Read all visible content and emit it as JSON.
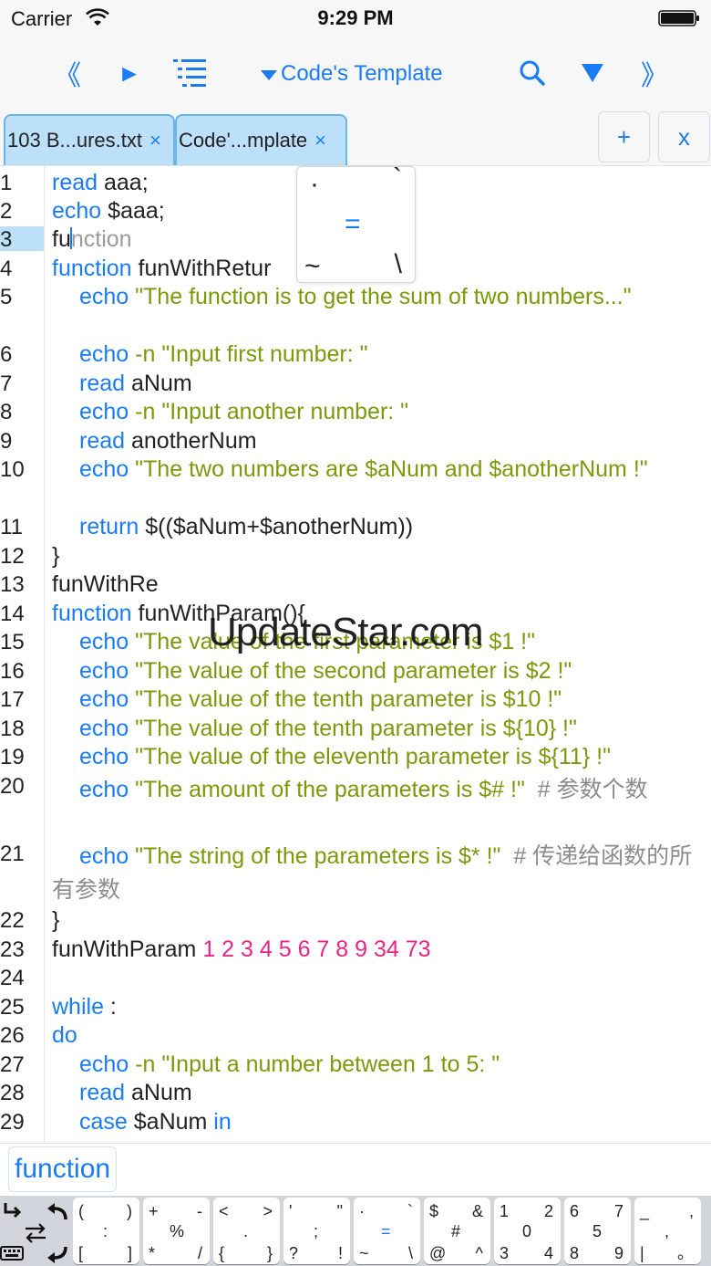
{
  "status_bar": {
    "carrier": "Carrier",
    "time": "9:29 PM"
  },
  "toolbar": {
    "prev_label": "《",
    "run_label": "►",
    "title": "Code's Template",
    "next_label": "》",
    "accent_color": "#1a7cf5"
  },
  "tabs": [
    {
      "label": "103 B...ures.txt",
      "close": "×"
    },
    {
      "label": "Code'...mplate",
      "close": "×"
    }
  ],
  "tab_actions": {
    "add": "+",
    "close": "x"
  },
  "editor": {
    "line_numbers": [
      "1",
      "2",
      "3",
      "4",
      "5",
      "6",
      "7",
      "8",
      "9",
      "10",
      "11",
      "12",
      "13",
      "14",
      "15",
      "16",
      "17",
      "18",
      "19",
      "20",
      "21",
      "22",
      "23",
      "24",
      "25",
      "26",
      "27",
      "28",
      "29"
    ],
    "current_line": "3",
    "lines": {
      "l1_kw": "read",
      "l1_rest": " aaa;",
      "l2_kw": "echo",
      "l2_rest": " $aaa;",
      "l3_typed_a": "fu",
      "l3_typed_b": "nction",
      "l4_kw": "function",
      "l4_rest": " funWithRetur",
      "l5_kw": "echo",
      "l5_str": " \"The function is to get the sum of two numbers...\"",
      "l6_kw": "echo",
      "l6_opt": " -n",
      "l6_str": " \"Input first number: \"",
      "l7_kw": "read",
      "l7_rest": " aNum",
      "l8_kw": "echo",
      "l8_opt": " -n",
      "l8_str": " \"Input another number: \"",
      "l9_kw": "read",
      "l9_rest": " anotherNum",
      "l10_kw": "echo",
      "l10_str": " \"The two numbers are $aNum and $anotherNum !\"",
      "l11_kw": "return",
      "l11_rest": " $(($aNum+$anotherNum))",
      "l12": "}",
      "l13": "funWithRe",
      "l14_kw": "function",
      "l14_rest": " funWithParam(){",
      "l15_kw": "echo",
      "l15_str": " \"The value of the first parameter is $1 !\"",
      "l16_kw": "echo",
      "l16_str": " \"The value of the second parameter is $2 !\"",
      "l17_kw": "echo",
      "l17_str": " \"The value of the tenth parameter is $10 !\"",
      "l18_kw": "echo",
      "l18_str": " \"The value of the tenth parameter is ${10} !\"",
      "l19_kw": "echo",
      "l19_str": " \"The value of the eleventh parameter is ${11} !\"",
      "l20_kw": "echo",
      "l20_str": " \"The amount of the parameters is $# !\"",
      "l20_cmt": "  # 参数个数",
      "l21_kw": "echo",
      "l21_str": " \"The string of the parameters is $* !\"",
      "l21_cmt": "  # 传递给函数的所有参数",
      "l22": "}",
      "l23_rest": "funWithParam",
      "l23_nums": " 1 2 3 4 5 6 7 8 9 34 73",
      "l25_kw": "while",
      "l25_rest": " :",
      "l26_kw": "do",
      "l27_kw": "echo",
      "l27_opt": " -n",
      "l27_str": " \"Input a number between 1 to 5: \"",
      "l28_kw": "read",
      "l28_rest": " aNum",
      "l29_kw": "case",
      "l29_rest": " $aNum ",
      "l29_kw2": "in"
    }
  },
  "symbol_popup": {
    "tl": "·",
    "tr": "`",
    "center": "=",
    "bl": "~",
    "br": "\\"
  },
  "watermark": "UpdateStar.com",
  "autocomplete": {
    "suggestion": "function"
  },
  "keyboard_row": {
    "keys": [
      {
        "tl": "(",
        "tr": ")",
        "c": ":",
        "bl": "[",
        "br": "]"
      },
      {
        "tl": "+",
        "tr": "-",
        "c": "%",
        "bl": "*",
        "br": "/"
      },
      {
        "tl": "<",
        "tr": ">",
        "c": ".",
        "bl": "{",
        "br": "}"
      },
      {
        "tl": "'",
        "tr": "\"",
        "c": ";",
        "bl": "?",
        "br": "!"
      },
      {
        "tl": "·",
        "tr": "`",
        "c": "=",
        "bl": "~",
        "br": "\\"
      },
      {
        "tl": "$",
        "tr": "&",
        "c": "#",
        "bl": "@",
        "br": "^"
      },
      {
        "tl": "1",
        "tr": "2",
        "c": "0",
        "bl": "3",
        "br": "4"
      },
      {
        "tl": "6",
        "tr": "7",
        "c": "5",
        "bl": "8",
        "br": "9"
      },
      {
        "tl": "_",
        "tr": ",",
        "c": ",",
        "bl": "|",
        "br": "。"
      }
    ]
  }
}
